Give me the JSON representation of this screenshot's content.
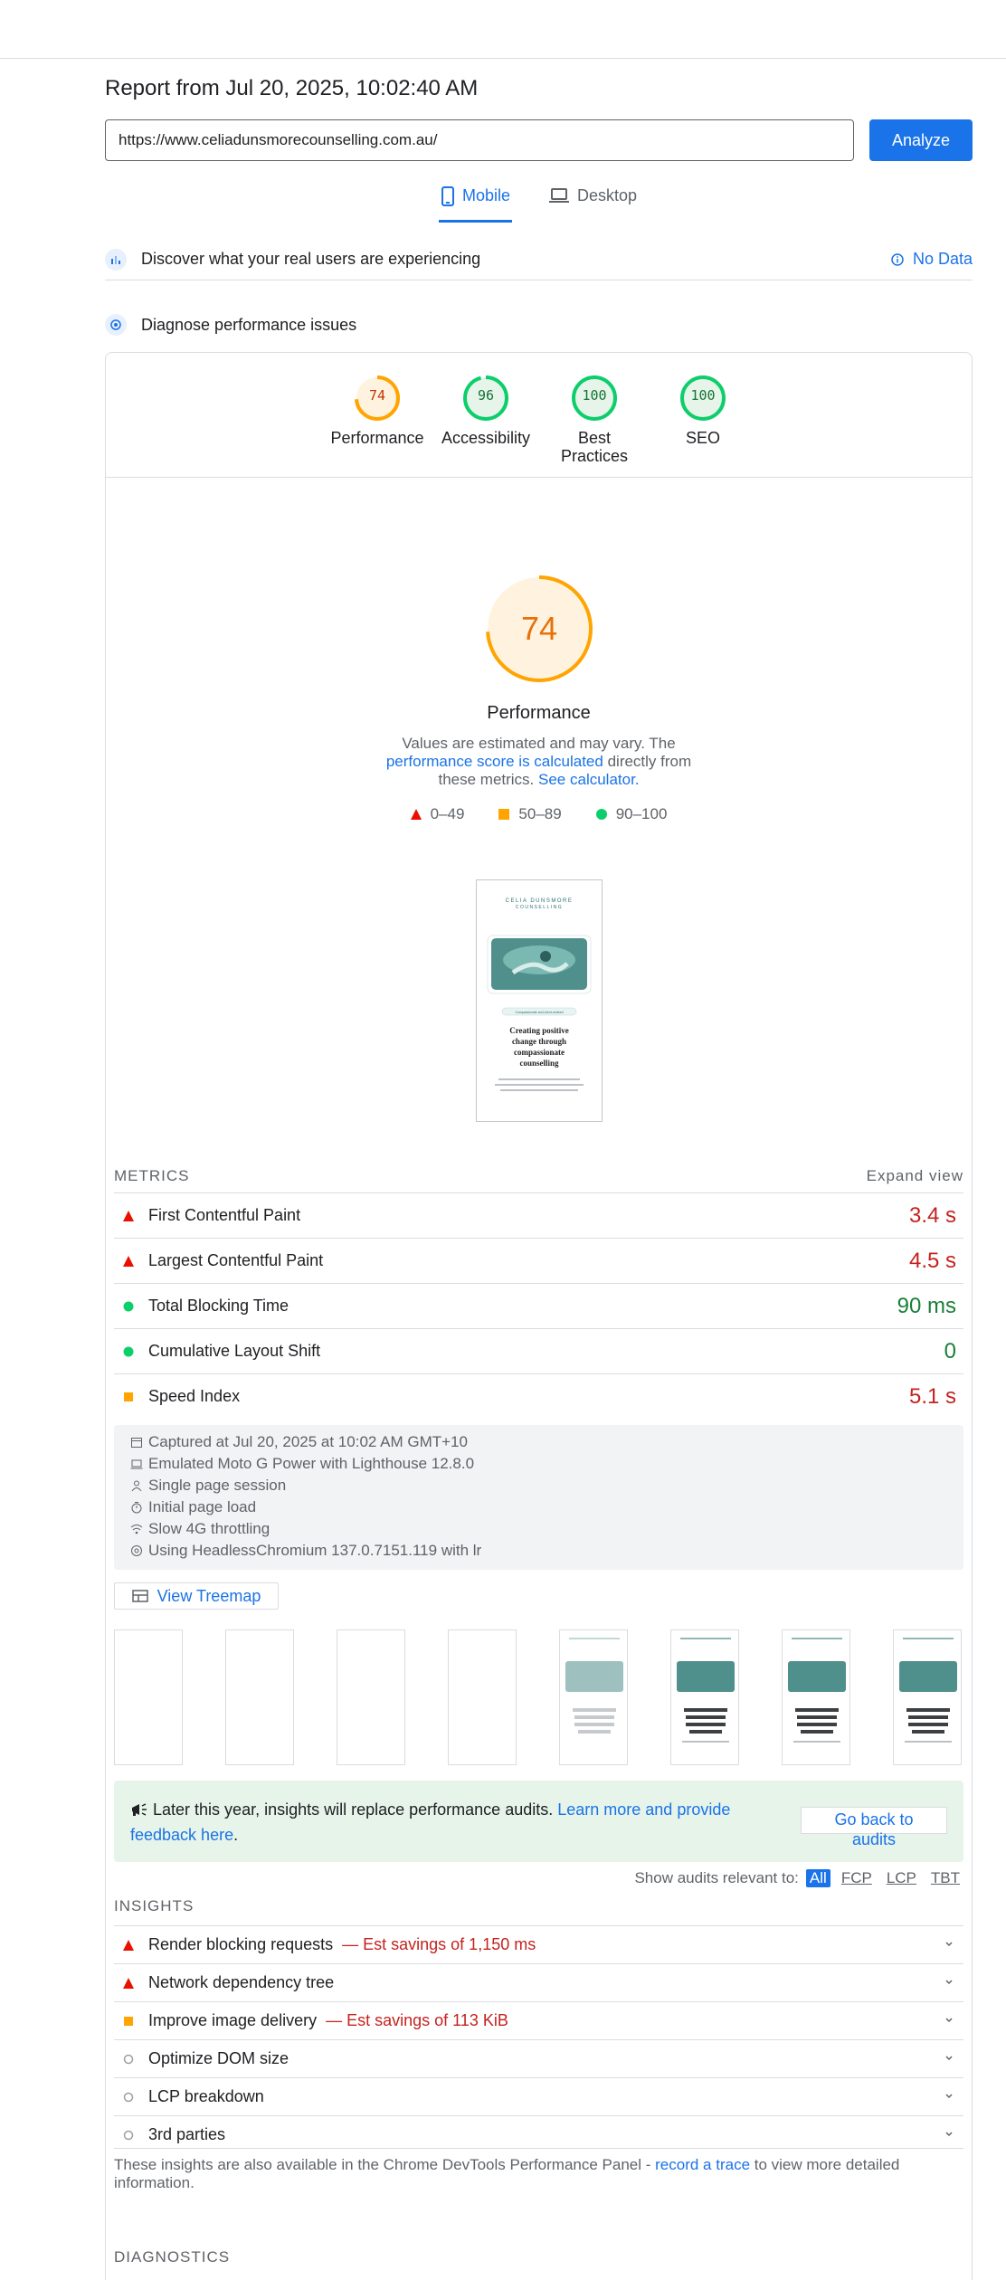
{
  "report": {
    "title": "Report from Jul 20, 2025, 10:02:40 AM",
    "url": "https://www.celiadunsmorecounselling.com.au/",
    "analyze_label": "Analyze"
  },
  "tabs": {
    "mobile": "Mobile",
    "desktop": "Desktop"
  },
  "crux": {
    "text": "Discover what your real users are experiencing",
    "no_data": "No Data"
  },
  "diagnose": {
    "text": "Diagnose performance issues"
  },
  "categories": [
    {
      "label": "Performance",
      "score": "74",
      "color": "#e8710a",
      "fraction": 0.74
    },
    {
      "label": "Accessibility",
      "score": "96",
      "color": "#0cce6b",
      "fraction": 0.96
    },
    {
      "label": "Best Practices",
      "label_line1": "Best",
      "label_line2": "Practices",
      "score": "100",
      "color": "#0cce6b",
      "fraction": 1.0
    },
    {
      "label": "SEO",
      "score": "100",
      "color": "#0cce6b",
      "fraction": 1.0
    }
  ],
  "performance": {
    "score": "74",
    "fraction": 0.74,
    "title": "Performance",
    "desc_start": "Values are estimated and may vary. The ",
    "desc_link1": "performance score is calculated",
    "desc_mid": " directly from these metrics. ",
    "desc_link2": "See calculator.",
    "legend": {
      "poor": "0–49",
      "average": "50–89",
      "good": "90–100"
    }
  },
  "screenshot": {
    "brand_line1": "CELIA DUNSMORE",
    "brand_line2": "COUNSELLING",
    "pill": "Compassionate and client-centred",
    "heading": "Creating positive change through compassionate counselling",
    "body": "Non-judgmental and compassionate, attachment-style of counselling to help you achieve and experience your therapy goals"
  },
  "metrics": {
    "header": "METRICS",
    "expand": "Expand view",
    "items": [
      {
        "name": "First Contentful Paint",
        "value": "3.4 s",
        "status": "poor"
      },
      {
        "name": "Largest Contentful Paint",
        "value": "4.5 s",
        "status": "poor"
      },
      {
        "name": "Total Blocking Time",
        "value": "90 ms",
        "status": "good"
      },
      {
        "name": "Cumulative Layout Shift",
        "value": "0",
        "status": "good"
      },
      {
        "name": "Speed Index",
        "value": "5.1 s",
        "status": "average"
      }
    ]
  },
  "environment": {
    "captured": "Captured at Jul 20, 2025 at 10:02 AM GMT+10",
    "device": "Emulated Moto G Power with Lighthouse 12.8.0",
    "session": "Single page session",
    "load": "Initial page load",
    "throttling": "Slow 4G throttling",
    "browser": "Using HeadlessChromium 137.0.7151.119 with lr"
  },
  "treemap": {
    "label": "View Treemap"
  },
  "notice": {
    "text": "Later this year, insights will replace performance audits. ",
    "link": "Learn more and provide feedback here",
    "end": ".",
    "back_line1": "Go back to",
    "back_line2": "audits"
  },
  "filter": {
    "label": "Show audits relevant to:",
    "all": "All",
    "fcp": "FCP",
    "lcp": "LCP",
    "tbt": "TBT"
  },
  "insights": {
    "header": "INSIGHTS",
    "items": [
      {
        "name": "Render blocking requests",
        "savings": "— Est savings of 1,150 ms",
        "status": "poor"
      },
      {
        "name": "Network dependency tree",
        "savings": "",
        "status": "poor"
      },
      {
        "name": "Improve image delivery",
        "savings": "— Est savings of 113 KiB",
        "status": "average"
      },
      {
        "name": "Optimize DOM size",
        "savings": "",
        "status": "info"
      },
      {
        "name": "LCP breakdown",
        "savings": "",
        "status": "info"
      },
      {
        "name": "3rd parties",
        "savings": "",
        "status": "info"
      }
    ],
    "footer_start": "These insights are also available in the Chrome DevTools Performance Panel - ",
    "footer_link": "record a trace",
    "footer_end": " to view more detailed information."
  },
  "diagnostics": {
    "header": "DIAGNOSTICS"
  },
  "colors": {
    "accent": "#1a73e8",
    "poor": "#eb0f00",
    "average": "#ffa400",
    "good": "#0cce6b"
  }
}
